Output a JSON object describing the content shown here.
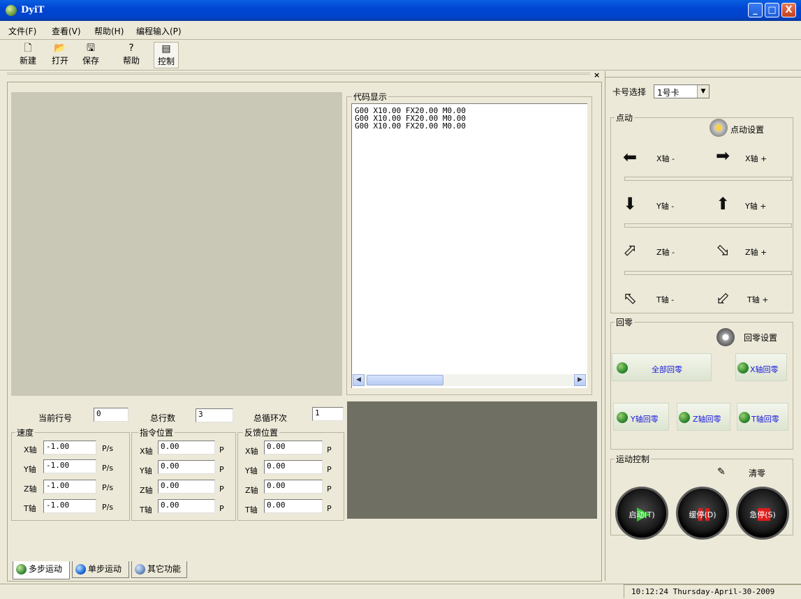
{
  "window": {
    "title": "DyiT",
    "minimize_glyph": "_",
    "maximize_glyph": "□",
    "close_glyph": "X"
  },
  "menu": [
    "文件(F)",
    "查看(V)",
    "帮助(H)",
    "编程输入(P)"
  ],
  "toolbar": [
    {
      "label": "新建",
      "icon": "new-file-icon",
      "glyph": "🗋"
    },
    {
      "label": "打开",
      "icon": "open-folder-icon",
      "glyph": "📂"
    },
    {
      "label": "保存",
      "icon": "save-disk-icon",
      "glyph": "🖫"
    },
    {
      "label": "帮助",
      "icon": "help-icon",
      "glyph": "?"
    },
    {
      "label": "控制",
      "icon": "control-icon",
      "glyph": "▤"
    }
  ],
  "pane_close": "×",
  "code_display": {
    "title": "代码显示",
    "lines": [
      "G00 X10.00 FX20.00 M0.00",
      "G00 X10.00 FX20.00 M0.00",
      "G00 X10.00 FX20.00 M0.00"
    ]
  },
  "counters": {
    "current_line_label": "当前行号",
    "current_line_value": "0",
    "total_lines_label": "总行数",
    "total_lines_value": "3",
    "total_loops_label": "总循环次",
    "total_loops_value": "1"
  },
  "speed": {
    "title": "速度",
    "unit": "P/s",
    "rows": [
      {
        "axis": "X轴",
        "value": "-1.00"
      },
      {
        "axis": "Y轴",
        "value": "-1.00"
      },
      {
        "axis": "Z轴",
        "value": "-1.00"
      },
      {
        "axis": "T轴",
        "value": "-1.00"
      }
    ]
  },
  "command_position": {
    "title": "指令位置",
    "unit": "P",
    "rows": [
      {
        "axis": "X轴",
        "value": "0.00"
      },
      {
        "axis": "Y轴",
        "value": "0.00"
      },
      {
        "axis": "Z轴",
        "value": "0.00"
      },
      {
        "axis": "T轴",
        "value": "0.00"
      }
    ]
  },
  "feedback_position": {
    "title": "反馈位置",
    "unit": "P",
    "rows": [
      {
        "axis": "X轴",
        "value": "0.00"
      },
      {
        "axis": "Y轴",
        "value": "0.00"
      },
      {
        "axis": "Z轴",
        "value": "0.00"
      },
      {
        "axis": "T轴",
        "value": "0.00"
      }
    ]
  },
  "card_select": {
    "label": "卡号选择",
    "value": "1号卡"
  },
  "jog": {
    "title": "点动",
    "settings_label": "点动设置",
    "x_minus": "X轴 -",
    "x_plus": "X轴 +",
    "y_minus": "Y轴 -",
    "y_plus": "Y轴 +",
    "z_minus": "Z轴 -",
    "z_plus": "Z轴 +",
    "t_minus": "T轴 -",
    "t_plus": "T轴 +"
  },
  "homing": {
    "title": "回零",
    "settings_label": "回零设置",
    "all": "全部回零",
    "x": "X轴回零",
    "y": "Y轴回零",
    "z": "Z轴回零",
    "t": "T轴回零"
  },
  "motion": {
    "title": "运动控制",
    "clear_label": "清零",
    "start": "启动(T)",
    "slow_stop": "缓停(D)",
    "emergency_stop": "急停(S)"
  },
  "tabs": [
    "多步运动",
    "单步运动",
    "其它功能"
  ],
  "status": {
    "datetime": "10:12:24   Thursday-April-30-2009"
  },
  "colors": {
    "title_bar": "#0046d5",
    "window_bg": "#ece9d8",
    "preview_area": "#c9c8b6",
    "dark_panel": "#706f63"
  }
}
